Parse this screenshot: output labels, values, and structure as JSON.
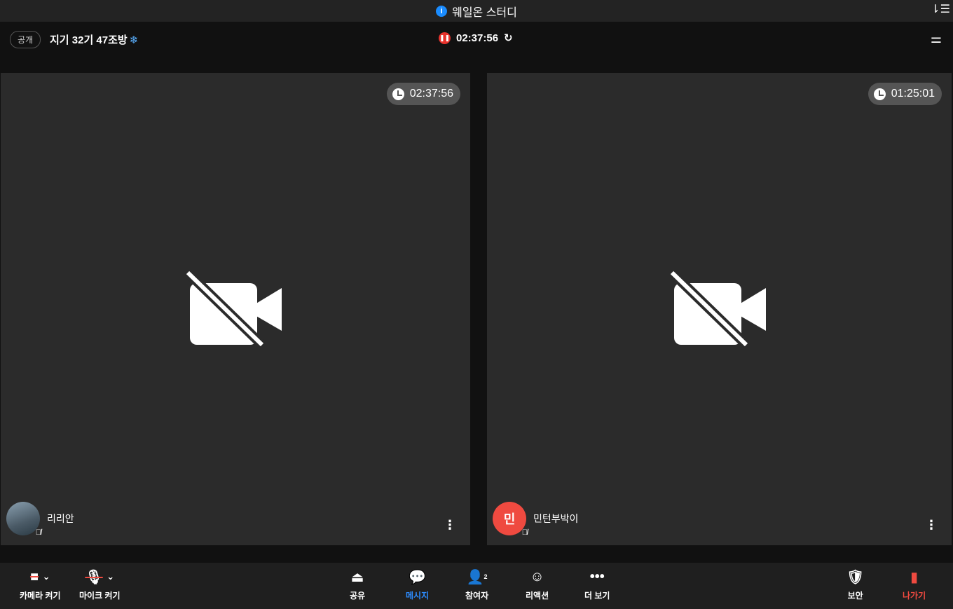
{
  "window": {
    "title": "웨일온 스터디"
  },
  "header": {
    "visibility_badge": "공개",
    "room_title": "지기 32기 47조방",
    "room_timer": "02:37:56"
  },
  "participants": [
    {
      "name": "리리안",
      "timer": "02:37:56",
      "avatar_initial": ""
    },
    {
      "name": "민턴부박이",
      "timer": "01:25:01",
      "avatar_initial": "민"
    }
  ],
  "toolbar": {
    "camera": "카메라 켜기",
    "mic": "마이크 켜기",
    "share": "공유",
    "message": "메시지",
    "participants": "참여자",
    "participants_count": "2",
    "reaction": "리액션",
    "more": "더 보기",
    "security": "보안",
    "leave": "나가기"
  },
  "colors": {
    "accent": "#2d8cff",
    "danger": "#ef4a40"
  }
}
